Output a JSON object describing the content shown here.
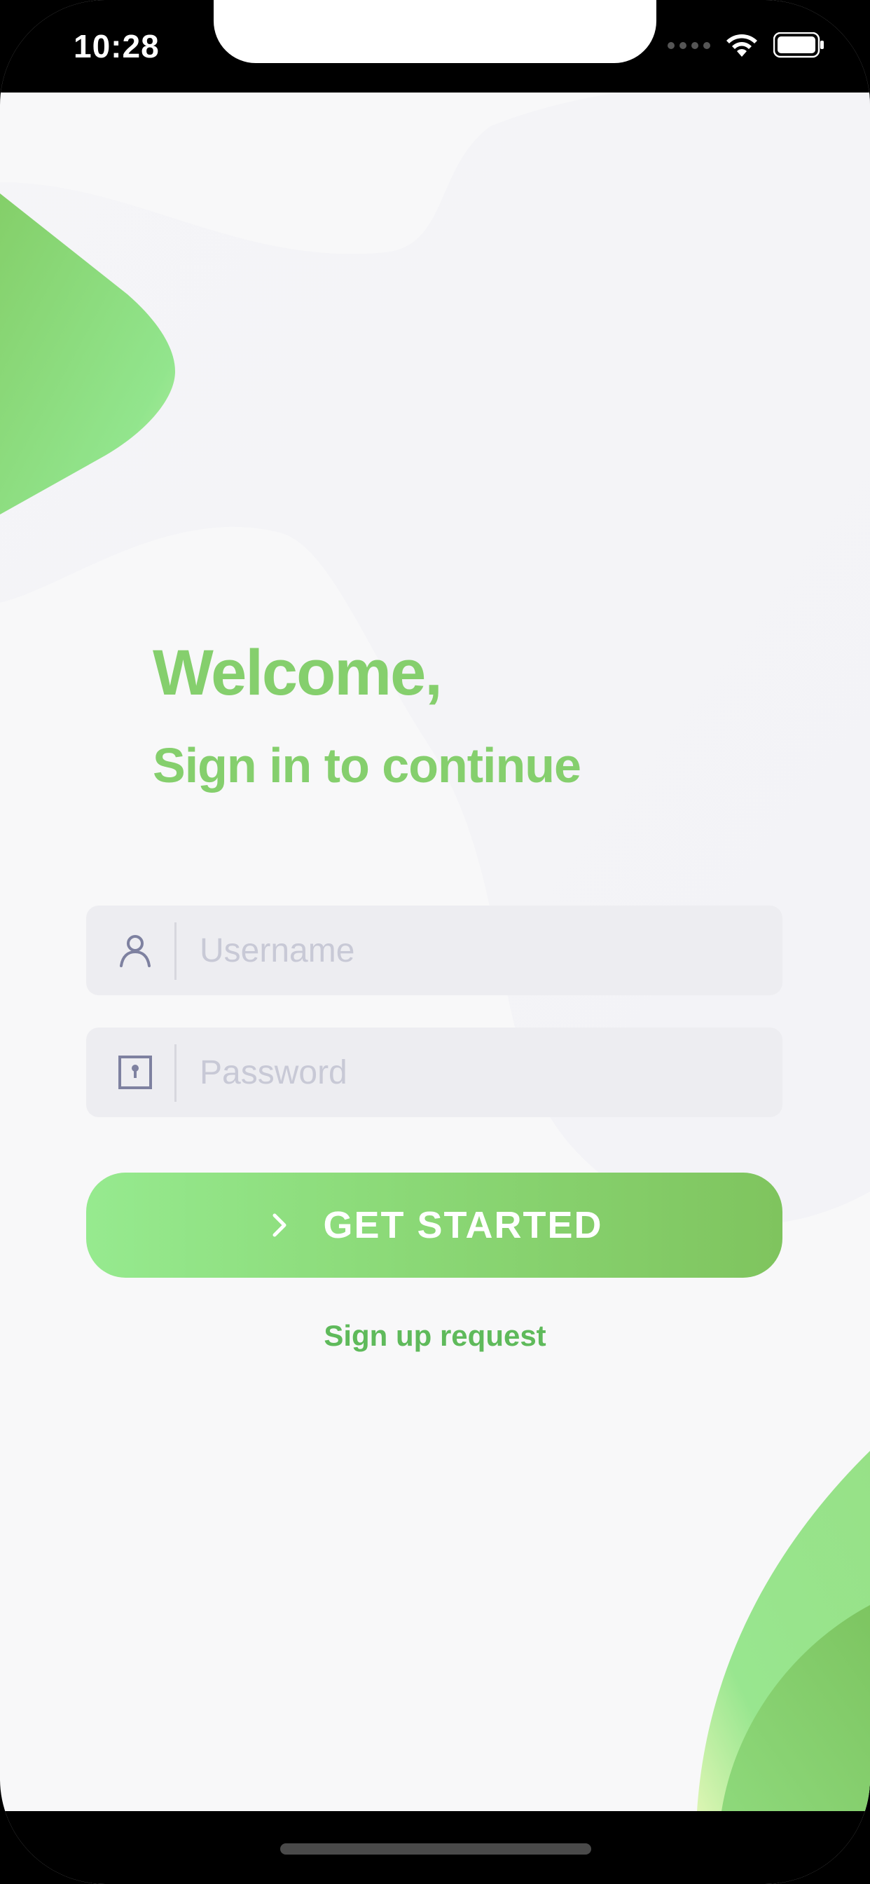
{
  "status_bar": {
    "time": "10:28",
    "wifi_icon": "wifi-icon",
    "battery_icon": "battery-icon"
  },
  "login": {
    "welcome": "Welcome,",
    "subtitle": "Sign in to continue",
    "username_placeholder": "Username",
    "password_placeholder": "Password",
    "username_value": "",
    "password_value": "",
    "get_started_label": "GET STARTED",
    "signup_label": "Sign up request"
  },
  "icons": {
    "user": "user-icon",
    "lock": "lock-icon",
    "chevron": "chevron-right-icon"
  },
  "colors": {
    "accent": "#85cf6d",
    "accent_dark": "#5fba5b",
    "field_bg": "#ededf1",
    "placeholder": "#c8c9d6",
    "background": "#f8f8f9"
  }
}
